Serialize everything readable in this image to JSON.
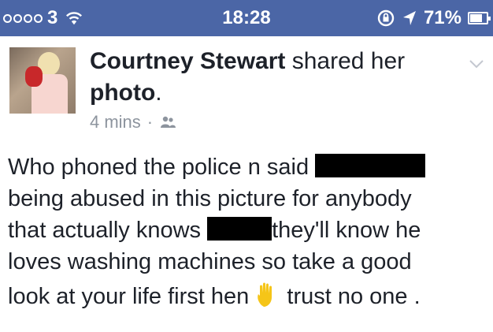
{
  "status_bar": {
    "carrier": "3",
    "time": "18:28",
    "battery": "71%",
    "signal_dots_filled": 0,
    "signal_dots_total": 4
  },
  "post": {
    "author": "Courtney Stewart",
    "action_text": "shared her",
    "object_text": "photo",
    "object_suffix": ".",
    "time_ago": "4 mins",
    "separator": "·",
    "audience_icon": "friends-icon",
    "text": {
      "line1": "Who phoned the police n said",
      "line2": "being abused in this picture  for anybody",
      "line3a": "that actually knows",
      "line3b": "they'll know he",
      "line4": "loves washing machines so take a good",
      "line5a": "look at your life first hen",
      "line5b": "trust no one ."
    }
  },
  "colors": {
    "status_bar": "#4b66a6",
    "text": "#1d2129",
    "meta": "#8d949e",
    "redaction": "#000000",
    "emoji_hand": "#f5c518"
  }
}
